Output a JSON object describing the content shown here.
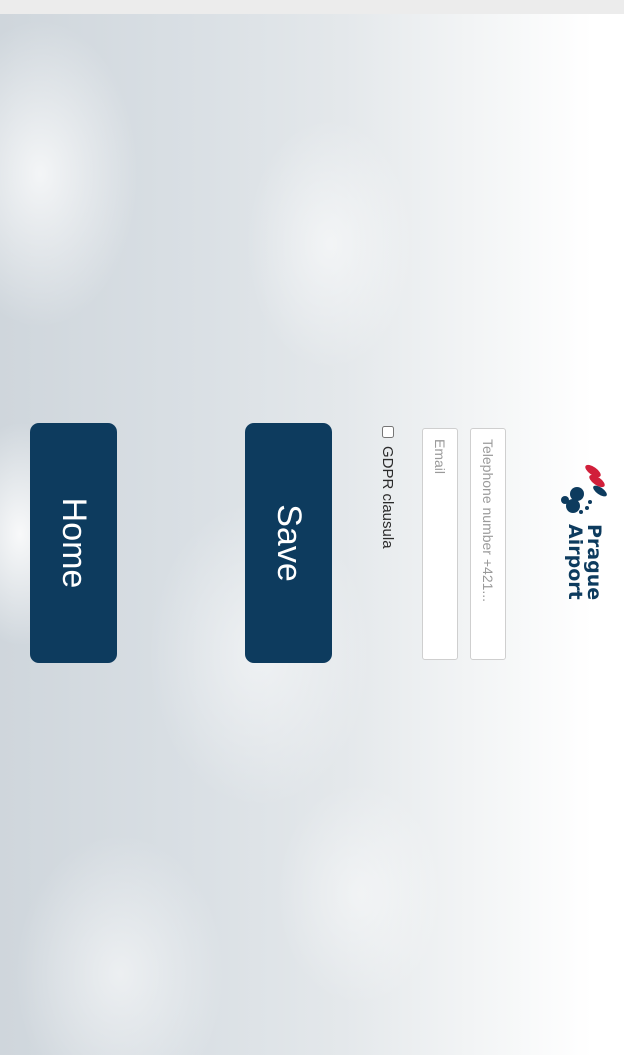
{
  "brand": {
    "logo_line1": "Prague",
    "logo_line2": "Airport"
  },
  "form": {
    "phone_placeholder": "Telephone number +421...",
    "email_placeholder": "Email",
    "gdpr_label": "GDPR clausula",
    "gdpr_checked": false
  },
  "actions": {
    "save_label": "Save",
    "home_label": "Home"
  },
  "colors": {
    "primary": "#0d3b5e",
    "logo_accent": "#d11f3a"
  }
}
